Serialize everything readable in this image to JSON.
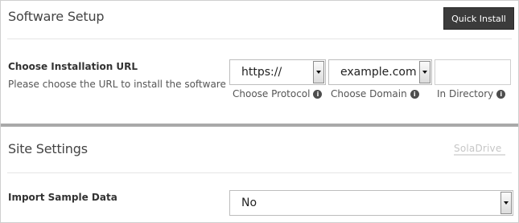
{
  "software_setup": {
    "title": "Software Setup",
    "quick_install_label": "Quick Install",
    "install_url": {
      "label": "Choose Installation URL",
      "description": "Please choose the URL to install the software",
      "protocol": {
        "value": "https://",
        "hint": "Choose Protocol"
      },
      "domain": {
        "value": "example.com",
        "hint": "Choose Domain"
      },
      "directory": {
        "value": "",
        "hint": "In Directory"
      }
    }
  },
  "site_settings": {
    "title": "Site Settings",
    "logo_text": "SolaDrive",
    "import_sample_data": {
      "label": "Import Sample Data",
      "value": "No"
    }
  },
  "icons": {
    "info": "info-icon",
    "dropdown": "chevron-down-icon"
  }
}
